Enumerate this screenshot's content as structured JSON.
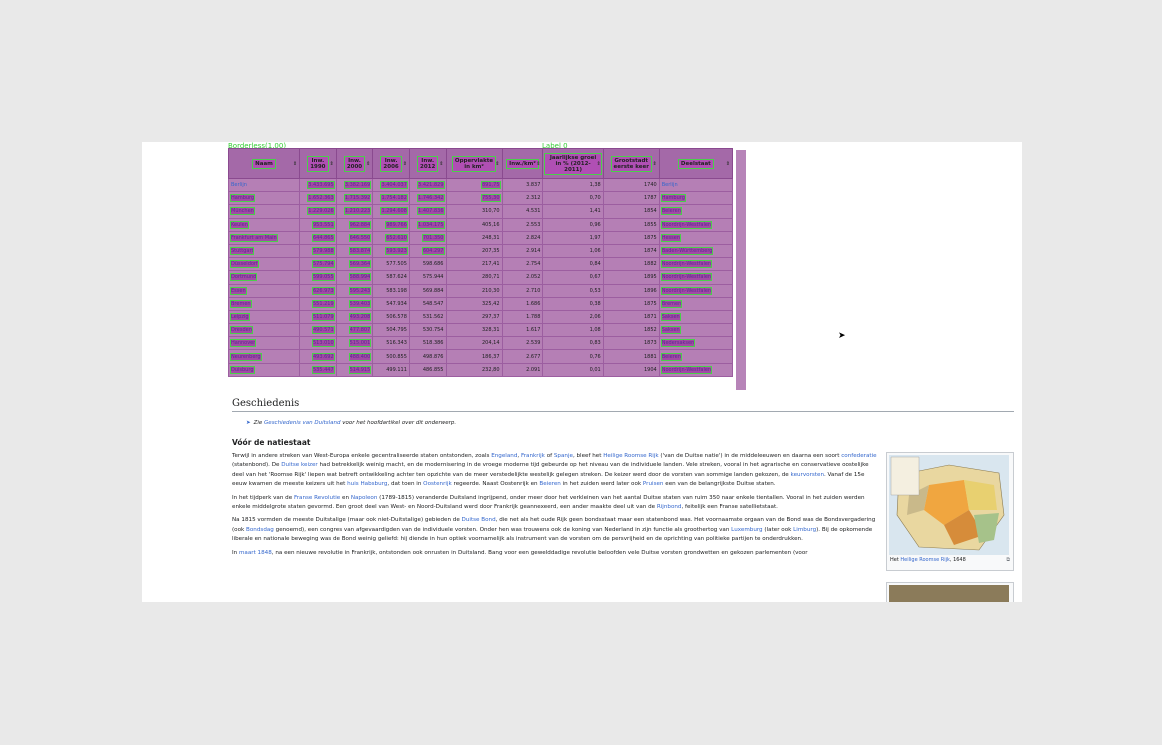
{
  "overlay": {
    "border_label": "Borderless(1.00)",
    "top_label": "Label 0"
  },
  "table": {
    "headers": [
      {
        "l1": "Naam",
        "l2": ""
      },
      {
        "l1": "Inw.",
        "l2": "1990"
      },
      {
        "l1": "Inw.",
        "l2": "2000"
      },
      {
        "l1": "Inw.",
        "l2": "2006"
      },
      {
        "l1": "Inw.",
        "l2": "2012"
      },
      {
        "l1": "Oppervlakte",
        "l2": "in km²"
      },
      {
        "l1": "Inw./km²",
        "l2": ""
      },
      {
        "l1": "Jaarlijkse groei",
        "l2": "in % (2012-2011)"
      },
      {
        "l1": "Grootstadt",
        "l2": "eerste keer"
      },
      {
        "l1": "Deelstaat",
        "l2": ""
      }
    ],
    "rows": [
      [
        "Berlijn",
        "3.433.695",
        "3.382.169",
        "3.404.037",
        "3.421.829",
        "891,75",
        "3.837",
        "1,38",
        "1740",
        "Berlijn"
      ],
      [
        "Hamburg",
        "1.652.363",
        "1.715.392",
        "1.754.182",
        "1.746.342",
        "755,30",
        "2.312",
        "0,70",
        "1787",
        "Hamburg"
      ],
      [
        "München",
        "1.229.026",
        "1.210.223",
        "1.294.608",
        "1.407.836",
        "310,70",
        "4.531",
        "1,41",
        "1854",
        "Beieren"
      ],
      [
        "Keulen",
        "953.551",
        "962.884",
        "989.766",
        "1.034.175",
        "405,16",
        "2.553",
        "0,96",
        "1855",
        "Noordrijn-Westfalen"
      ],
      [
        "Frankfurt am Main",
        "644.865",
        "646.550",
        "652.610",
        "701.350",
        "248,31",
        "2.824",
        "1,97",
        "1875",
        "Hessen"
      ],
      [
        "Stuttgart",
        "579.988",
        "583.874",
        "593.923",
        "604.297",
        "207,35",
        "2.914",
        "1,06",
        "1874",
        "Baden-Württemberg"
      ],
      [
        "Düsseldorf",
        "575.794",
        "569.364",
        "577.505",
        "598.686",
        "217,41",
        "2.754",
        "0,84",
        "1882",
        "Noordrijn-Westfalen"
      ],
      [
        "Dortmund",
        "599.055",
        "588.994",
        "587.624",
        "575.944",
        "280,71",
        "2.052",
        "0,67",
        "1895",
        "Noordrijn-Westfalen"
      ],
      [
        "Essen",
        "626.973",
        "595.243",
        "583.198",
        "569.884",
        "210,30",
        "2.710",
        "0,53",
        "1896",
        "Noordrijn-Westfalen"
      ],
      [
        "Bremen",
        "551.219",
        "539.403",
        "547.934",
        "548.547",
        "325,42",
        "1.686",
        "0,38",
        "1875",
        "Bremen"
      ],
      [
        "Leipzig",
        "511.079",
        "493.208",
        "506.578",
        "531.562",
        "297,37",
        "1.788",
        "2,06",
        "1871",
        "Saksen"
      ],
      [
        "Dresden",
        "490.571",
        "477.807",
        "504.795",
        "530.754",
        "328,31",
        "1.617",
        "1,08",
        "1852",
        "Saksen"
      ],
      [
        "Hannover",
        "513.010",
        "515.001",
        "516.343",
        "518.386",
        "204,14",
        "2.539",
        "0,83",
        "1873",
        "Nedersaksen"
      ],
      [
        "Neurenberg",
        "493.692",
        "488.400",
        "500.855",
        "498.876",
        "186,37",
        "2.677",
        "0,76",
        "1881",
        "Beieren"
      ],
      [
        "Duisburg",
        "535.447",
        "514.915",
        "499.111",
        "486.855",
        "232,80",
        "2.091",
        "0,01",
        "1904",
        "Noordrijn-Westfalen"
      ]
    ]
  },
  "section": {
    "title": "Geschiedenis"
  },
  "hatnote": {
    "prefix": "Zie ",
    "link": "Geschiedenis van Duitsland",
    "suffix": " voor het hoofdartikel over dit onderwerp."
  },
  "subsection": {
    "title": "Vóór de natiestaat"
  },
  "paragraphs": [
    {
      "parts": [
        [
          "t",
          "Terwijl in andere streken van West-Europa enkele gecentraliseerde staten ontstonden, zoals "
        ],
        [
          "a",
          "Engeland"
        ],
        [
          "t",
          ", "
        ],
        [
          "a",
          "Frankrijk"
        ],
        [
          "t",
          " of "
        ],
        [
          "a",
          "Spanje"
        ],
        [
          "t",
          ", bleef het "
        ],
        [
          "a",
          "Heilige Roomse Rijk"
        ],
        [
          "t",
          " ('van de Duitse natie') in de middeleeuwen en daarna een soort "
        ],
        [
          "a",
          "confederatie"
        ],
        [
          "t",
          " (statenbond). De "
        ],
        [
          "a",
          "Duitse keizer"
        ],
        [
          "t",
          " had betrekkelijk weinig macht, en de modernisering in de vroege moderne tijd gebeurde op het niveau van de individuele landen. Vele streken, vooral in het agrarische en conservatieve oostelijke deel van het 'Roomse Rijk' liepen wat betreft ontwikkeling achter ten opzichte van de meer verstedelijkte westelijk gelegen streken. De keizer werd door de vorsten van sommige landen gekozen, de "
        ],
        [
          "a",
          "keurvorsten"
        ],
        [
          "t",
          ". Vanaf de 15e eeuw kwamen de meeste keizers uit het "
        ],
        [
          "a",
          "huis Habsburg"
        ],
        [
          "t",
          ", dat toen in "
        ],
        [
          "a",
          "Oostenrijk"
        ],
        [
          "t",
          " regeerde. Naast Oostenrijk en "
        ],
        [
          "a",
          "Beieren"
        ],
        [
          "t",
          " in het zuiden werd later ook "
        ],
        [
          "a",
          "Pruisen"
        ],
        [
          "t",
          " een van de belangrijkste Duitse staten."
        ]
      ]
    },
    {
      "parts": [
        [
          "t",
          "In het tijdperk van de "
        ],
        [
          "a",
          "Franse Revolutie"
        ],
        [
          "t",
          " en "
        ],
        [
          "a",
          "Napoleon"
        ],
        [
          "t",
          " (1789-1815) veranderde Duitsland ingrijpend, onder meer door het verkleinen van het aantal Duitse staten van ruim 350 naar enkele tientallen. Vooral in het zuiden werden enkele middelgrote staten gevormd. Een groot deel van West- en Noord-Duitsland werd door Frankrijk geannexeerd, een ander maakte deel uit van de "
        ],
        [
          "a",
          "Rijnbond"
        ],
        [
          "t",
          ", feitelijk een Franse satellietstaat."
        ]
      ]
    },
    {
      "parts": [
        [
          "t",
          "Na 1815 vormden de meeste Duitstalige (maar ook niet-Duitstalige) gebieden de "
        ],
        [
          "a",
          "Duitse Bond"
        ],
        [
          "t",
          ", die net als het oude Rijk geen bondsstaat maar een statenbond was. Het voornaamste orgaan van de Bond was de Bondsvergadering (ook "
        ],
        [
          "a",
          "Bondsdag"
        ],
        [
          "t",
          " genoemd), een congres van afgevaardigden van de individuele vorsten. Onder hen was trouwens ook de koning van Nederland in zijn functie als groothertog van "
        ],
        [
          "a",
          "Luxemburg"
        ],
        [
          "t",
          " (later ook "
        ],
        [
          "a",
          "Limburg"
        ],
        [
          "t",
          "). Bij de opkomende liberale en nationale beweging was de Bond weinig geliefd: hij diende in hun optiek voornamelijk als instrument van de vorsten om de persvrijheid en de oprichting van politieke partijen te onderdrukken."
        ]
      ]
    },
    {
      "parts": [
        [
          "t",
          "In "
        ],
        [
          "a",
          "maart 1848"
        ],
        [
          "t",
          ", na een nieuwe revolutie in Frankrijk, ontstonden ook onrusten in Duitsland. Bang voor een gewelddadige revolutie beloofden vele Duitse vorsten grondwetten en gekozen parlementen (voor"
        ]
      ]
    }
  ],
  "figure": {
    "caption_prefix": "Het ",
    "caption_link": "Heilige Roomse Rijk",
    "caption_suffix": ", 1648",
    "enlarge_icon": "⧉"
  },
  "colors": {
    "table_bg": "#b57fb5",
    "overlay_green": "#33cc33",
    "link": "#3366cc"
  }
}
